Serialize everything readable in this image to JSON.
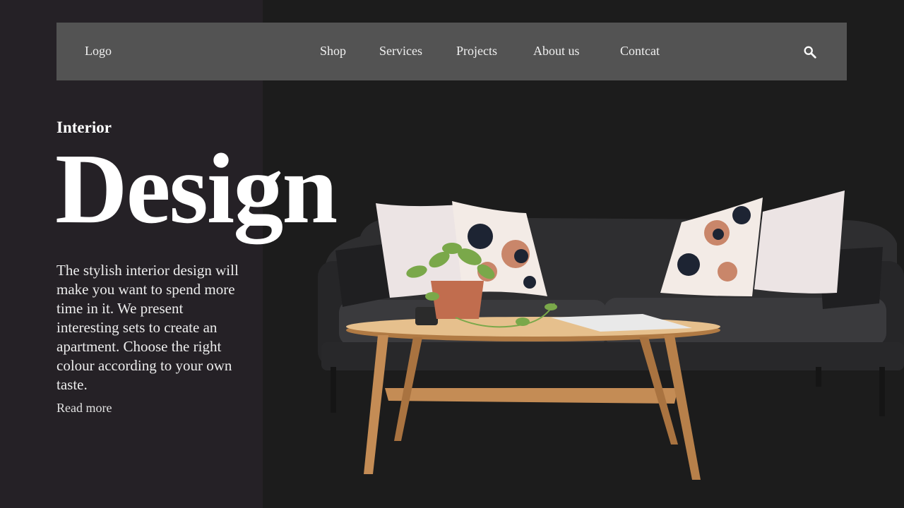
{
  "header": {
    "logo": "Logo",
    "nav": [
      "Shop",
      "Services",
      "Projects",
      "About us",
      "Contcat"
    ],
    "search_icon": "search-icon"
  },
  "hero": {
    "subtitle": "Interior",
    "title": "Design",
    "description": "The stylish interior design will make you want to spend more time in it. We present interesting sets to create an apartment. Choose the right colour according to your own taste.",
    "read_more": "Read more"
  },
  "colors": {
    "page_background": "#1c1c1c",
    "left_panel": "#252126",
    "navbar": "#535353",
    "text": "#ffffff"
  }
}
